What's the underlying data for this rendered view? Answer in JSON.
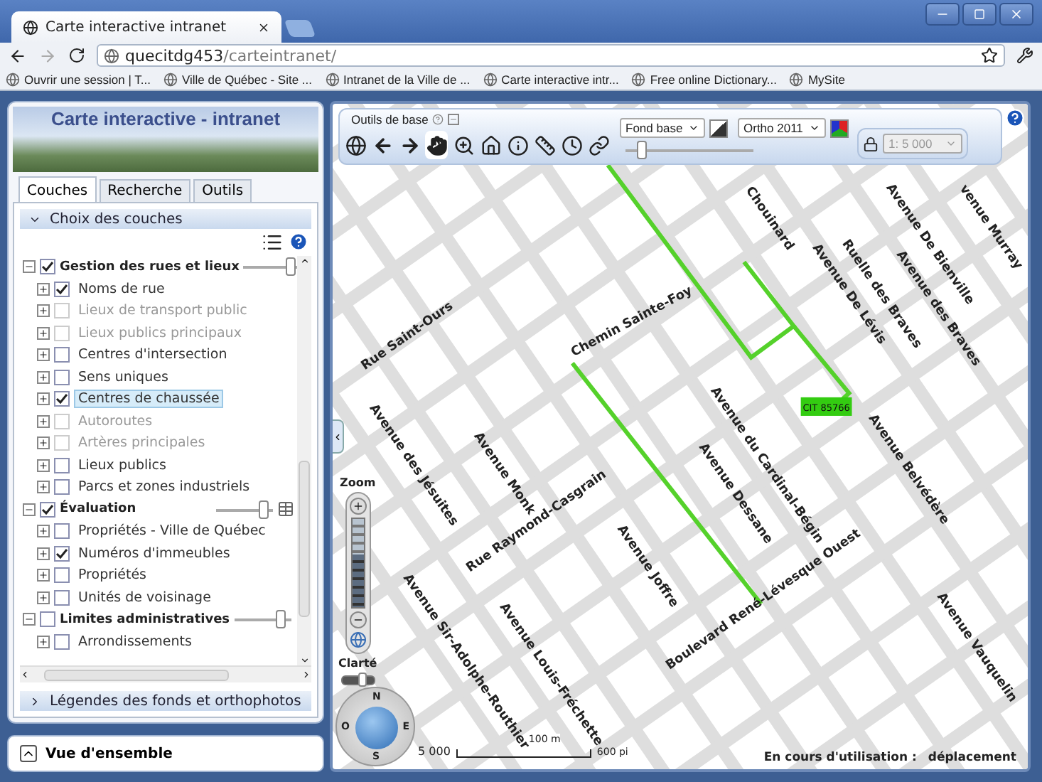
{
  "browser": {
    "tab": {
      "title": "Carte interactive intranet"
    },
    "address": {
      "host": "quecitdg453",
      "path": "/carteintranet/"
    },
    "bookmarks": [
      {
        "label": "Ouvrir une session | T..."
      },
      {
        "label": "Ville de Québec - Site ..."
      },
      {
        "label": "Intranet de la Ville de ..."
      },
      {
        "label": "Carte interactive intr..."
      },
      {
        "label": "Free online Dictionary..."
      },
      {
        "label": "MySite"
      }
    ]
  },
  "sidebar": {
    "title": "Carte interactive - intranet",
    "tabs": [
      {
        "label": "Couches",
        "selected": true
      },
      {
        "label": "Recherche",
        "selected": false
      },
      {
        "label": "Outils",
        "selected": false
      }
    ],
    "layers_panel": {
      "title": "Choix des couches",
      "expanded": true
    },
    "layer_groups": [
      {
        "label": "Gestion des rues et lieux",
        "checked": true,
        "level": 0.9,
        "children": [
          {
            "label": "Noms de rue",
            "checked": true,
            "disabled": false,
            "selected": false
          },
          {
            "label": "Lieux de transport public",
            "checked": false,
            "disabled": true,
            "selected": false
          },
          {
            "label": "Lieux publics principaux",
            "checked": false,
            "disabled": true,
            "selected": false
          },
          {
            "label": "Centres d'intersection",
            "checked": false,
            "disabled": false,
            "selected": false
          },
          {
            "label": "Sens uniques",
            "checked": false,
            "disabled": false,
            "selected": false
          },
          {
            "label": "Centres de chaussée",
            "checked": true,
            "disabled": false,
            "selected": true
          },
          {
            "label": "Autoroutes",
            "checked": false,
            "disabled": true,
            "selected": false
          },
          {
            "label": "Artères principales",
            "checked": false,
            "disabled": true,
            "selected": false
          },
          {
            "label": "Lieux publics",
            "checked": false,
            "disabled": false,
            "selected": false
          },
          {
            "label": "Parcs et zones industriels",
            "checked": false,
            "disabled": false,
            "selected": false
          }
        ]
      },
      {
        "label": "Évaluation",
        "checked": true,
        "level": 0.9,
        "children": [
          {
            "label": "Propriétés - Ville de Québec",
            "checked": false,
            "disabled": false,
            "selected": false
          },
          {
            "label": "Numéros d'immeubles",
            "checked": true,
            "disabled": false,
            "selected": false
          },
          {
            "label": "Propriétés",
            "checked": false,
            "disabled": false,
            "selected": false
          },
          {
            "label": "Unités de voisinage",
            "checked": false,
            "disabled": false,
            "selected": false
          }
        ]
      },
      {
        "label": "Limites administratives",
        "checked": false,
        "level": 0.9,
        "children": [
          {
            "label": "Arrondissements",
            "checked": false,
            "disabled": false,
            "selected": false
          }
        ]
      }
    ],
    "legend_panel": {
      "title": "Légendes des fonds et orthophotos",
      "expanded": false
    },
    "overview": {
      "title": "Vue d'ensemble",
      "expanded": false
    }
  },
  "map": {
    "toolbar": {
      "title": "Outils de base",
      "tools": [
        {
          "kind": "globe",
          "selected": false
        },
        {
          "kind": "back",
          "selected": false
        },
        {
          "kind": "forward",
          "selected": false
        },
        {
          "kind": "pan",
          "selected": true
        },
        {
          "kind": "zoom",
          "selected": false
        },
        {
          "kind": "home",
          "selected": false
        },
        {
          "kind": "info",
          "selected": false
        },
        {
          "kind": "measure",
          "selected": false
        },
        {
          "kind": "clock",
          "selected": false
        },
        {
          "kind": "link",
          "selected": false
        }
      ],
      "basemap": {
        "value": "Fond base"
      },
      "ortho": {
        "value": "Ortho 2011"
      },
      "opacity": {
        "level": 0.1
      },
      "scale": {
        "value": "1: 5 000",
        "disabled": true
      }
    },
    "streets": [
      "Rue Saint-Ours",
      "Chemin Sainte-Foy",
      "Avenue des Jésuites",
      "Avenue Monk",
      "Rue Raymond-Casgrain",
      "Avenue Joffre",
      "Avenue Dessane",
      "Avenue du Cardinal-Bégin",
      "Avenue Belvédère",
      "Boulevard René-Lévesque Ouest",
      "Avenue Vauquelin",
      "Avenue Sir-Adolphe-Routhier",
      "Avenue Louis-Fréchette",
      "Avenue De Lévis",
      "Ruelle des Braves",
      "Avenue des Braves",
      "Avenue De Bienville",
      "venue Murray",
      "Chouinard"
    ],
    "feature_label": "CIT 85766",
    "zoom": {
      "label": "Zoom",
      "level": 0.6
    },
    "brightness": {
      "label": "Clarté",
      "level": 0.7
    },
    "compass": {
      "north": "N",
      "south": "S",
      "east": "E",
      "west": "O"
    },
    "scale_bar": {
      "ratio": "5 000",
      "metric": "100 m",
      "imperial": "600 pi"
    },
    "status": {
      "label": "En cours d'utilisation :",
      "value": "déplacement"
    }
  }
}
